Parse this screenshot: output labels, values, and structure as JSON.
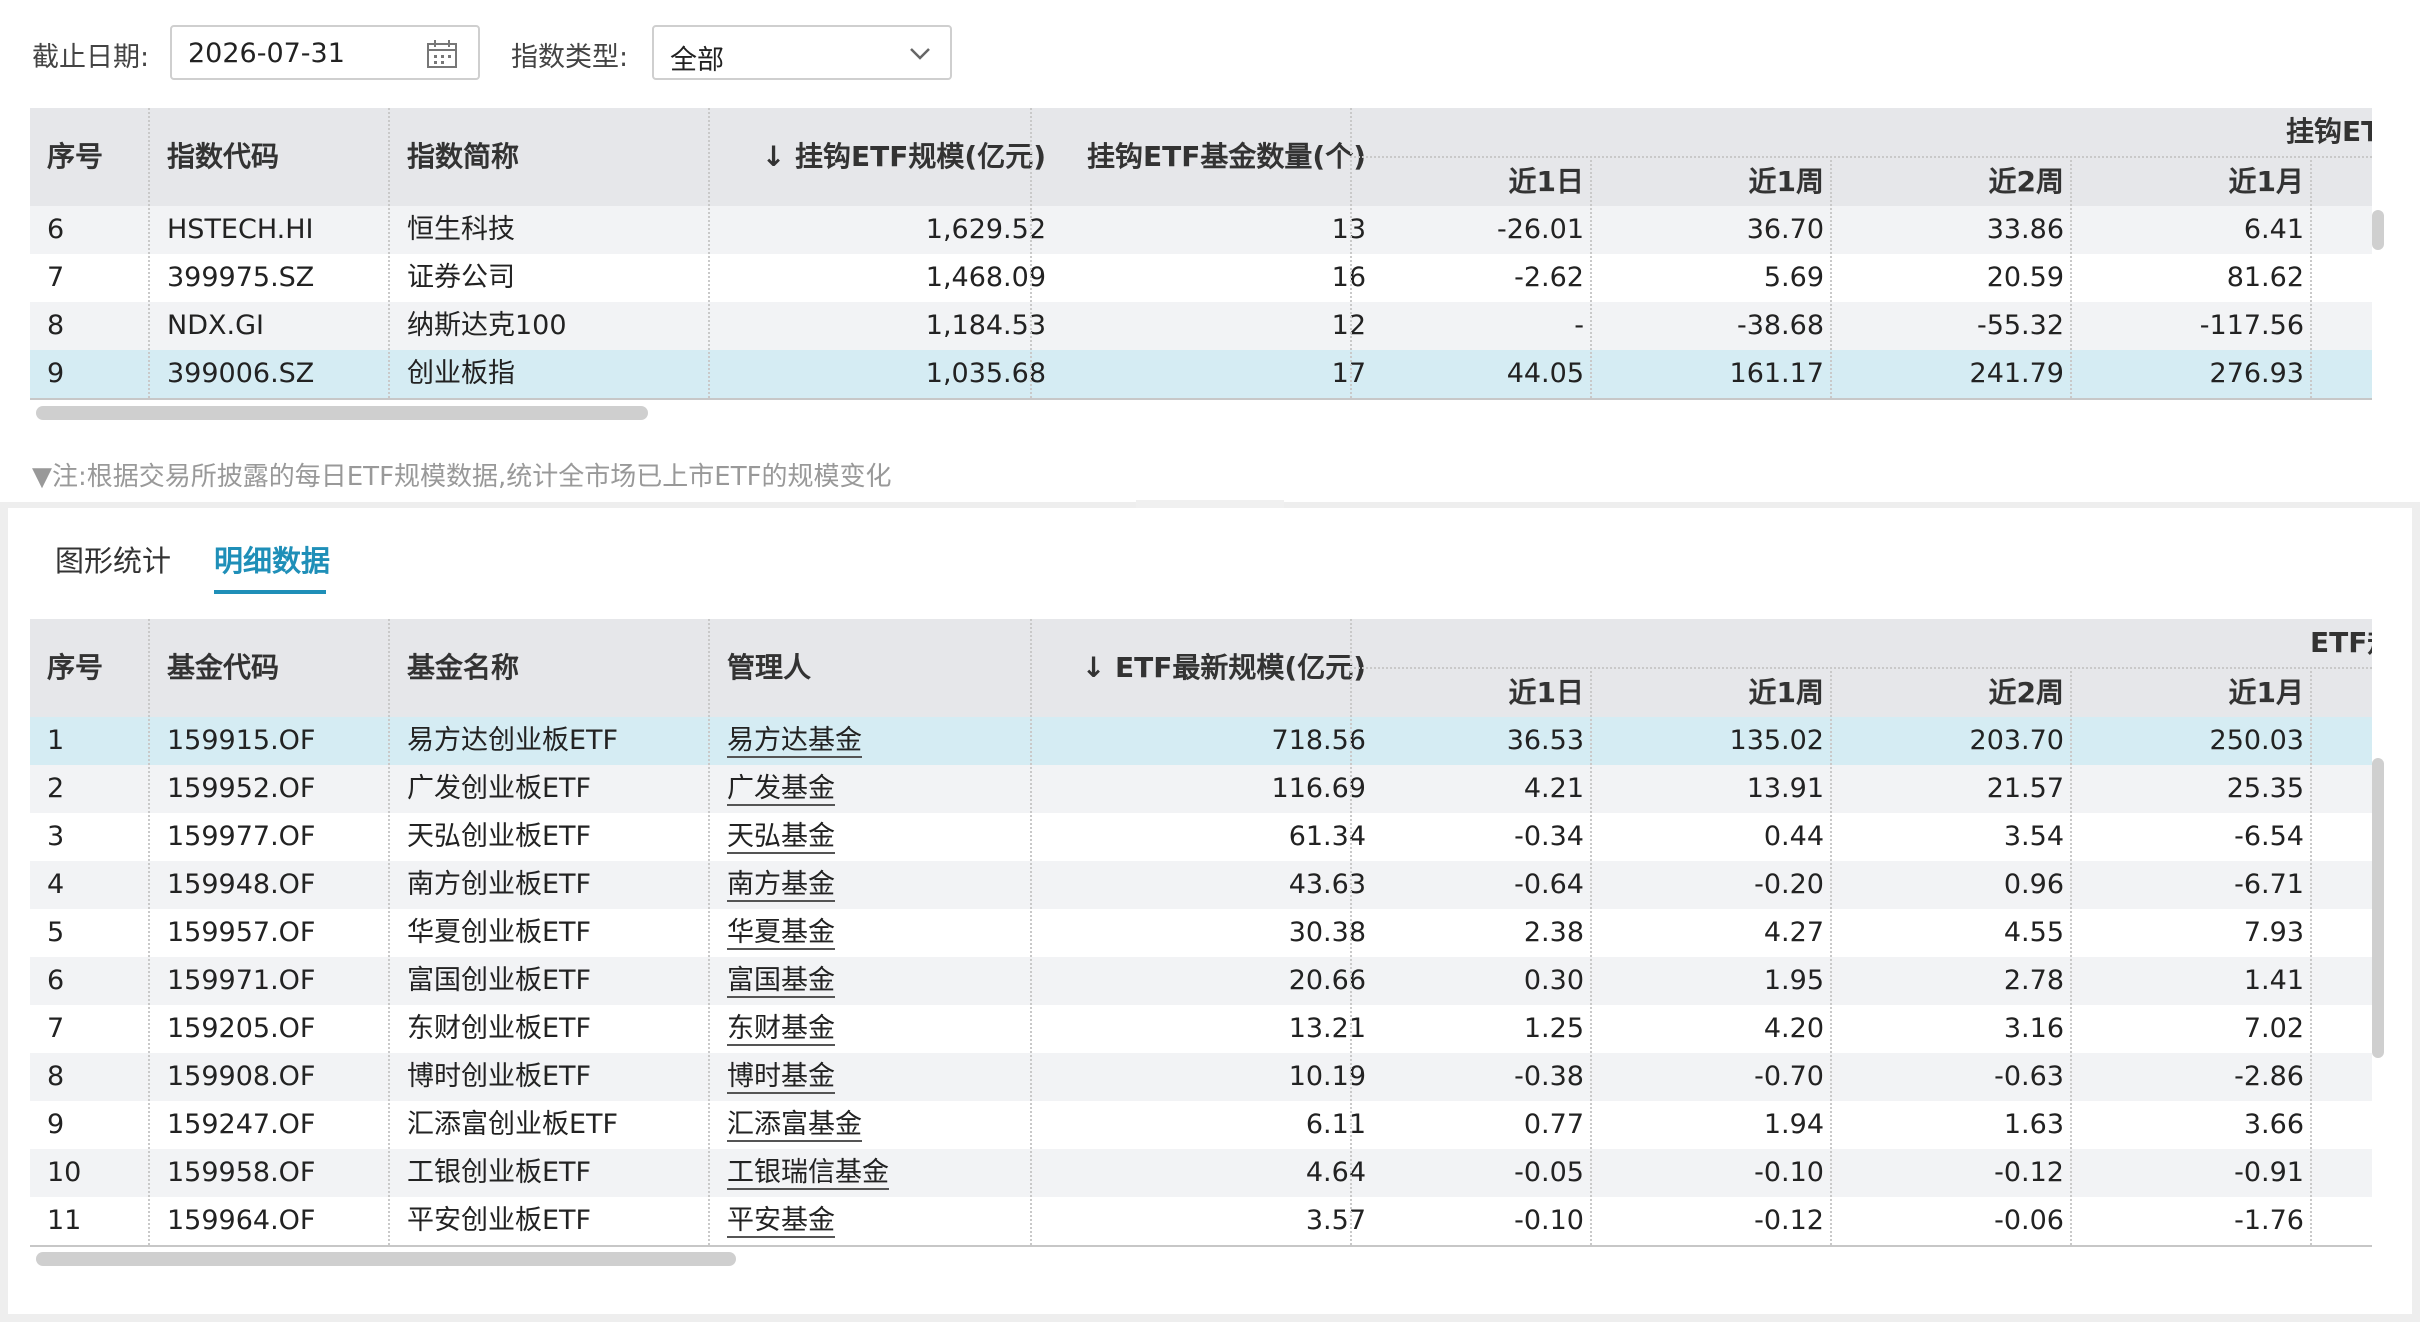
{
  "filters": {
    "date_label": "截止日期:",
    "date_value": "2026-07-31",
    "type_label": "指数类型:",
    "type_value": "全部"
  },
  "index_table": {
    "columns": {
      "seq": "序号",
      "code": "指数代码",
      "name": "指数简称",
      "scale": "↓ 挂钩ETF规模(亿元)",
      "count": "挂钩ETF基金数量(个)",
      "group": "挂钩ET",
      "d1": "近1日",
      "w1": "近1周",
      "w2": "近2周",
      "m1": "近1月"
    },
    "rows": [
      {
        "seq": "6",
        "code": "HSTECH.HI",
        "name": "恒生科技",
        "scale": "1,629.52",
        "count": "13",
        "d1": "-26.01",
        "w1": "36.70",
        "w2": "33.86",
        "m1": "6.41"
      },
      {
        "seq": "7",
        "code": "399975.SZ",
        "name": "证券公司",
        "scale": "1,468.09",
        "count": "16",
        "d1": "-2.62",
        "w1": "5.69",
        "w2": "20.59",
        "m1": "81.62"
      },
      {
        "seq": "8",
        "code": "NDX.GI",
        "name": "纳斯达克100",
        "scale": "1,184.53",
        "count": "12",
        "d1": "-",
        "w1": "-38.68",
        "w2": "-55.32",
        "m1": "-117.56"
      },
      {
        "seq": "9",
        "code": "399006.SZ",
        "name": "创业板指",
        "scale": "1,035.68",
        "count": "17",
        "d1": "44.05",
        "w1": "161.17",
        "w2": "241.79",
        "m1": "276.93"
      }
    ],
    "selected_row": 3
  },
  "note": "▼注:根据交易所披露的每日ETF规模数据,统计全市场已上市ETF的规模变化",
  "collapse_glyph": "⌄⌄",
  "tabs": [
    {
      "label": "图形统计",
      "active": false
    },
    {
      "label": "明细数据",
      "active": true
    }
  ],
  "fund_table": {
    "columns": {
      "seq": "序号",
      "code": "基金代码",
      "name": "基金名称",
      "manager": "管理人",
      "scale": "↓ ETF最新规模(亿元)",
      "group": "ETF规",
      "d1": "近1日",
      "w1": "近1周",
      "w2": "近2周",
      "m1": "近1月"
    },
    "rows": [
      {
        "seq": "1",
        "code": "159915.OF",
        "name": "易方达创业板ETF",
        "manager": "易方达基金",
        "scale": "718.56",
        "d1": "36.53",
        "w1": "135.02",
        "w2": "203.70",
        "m1": "250.03"
      },
      {
        "seq": "2",
        "code": "159952.OF",
        "name": "广发创业板ETF",
        "manager": "广发基金",
        "scale": "116.69",
        "d1": "4.21",
        "w1": "13.91",
        "w2": "21.57",
        "m1": "25.35"
      },
      {
        "seq": "3",
        "code": "159977.OF",
        "name": "天弘创业板ETF",
        "manager": "天弘基金",
        "scale": "61.34",
        "d1": "-0.34",
        "w1": "0.44",
        "w2": "3.54",
        "m1": "-6.54"
      },
      {
        "seq": "4",
        "code": "159948.OF",
        "name": "南方创业板ETF",
        "manager": "南方基金",
        "scale": "43.63",
        "d1": "-0.64",
        "w1": "-0.20",
        "w2": "0.96",
        "m1": "-6.71"
      },
      {
        "seq": "5",
        "code": "159957.OF",
        "name": "华夏创业板ETF",
        "manager": "华夏基金",
        "scale": "30.38",
        "d1": "2.38",
        "w1": "4.27",
        "w2": "4.55",
        "m1": "7.93"
      },
      {
        "seq": "6",
        "code": "159971.OF",
        "name": "富国创业板ETF",
        "manager": "富国基金",
        "scale": "20.66",
        "d1": "0.30",
        "w1": "1.95",
        "w2": "2.78",
        "m1": "1.41"
      },
      {
        "seq": "7",
        "code": "159205.OF",
        "name": "东财创业板ETF",
        "manager": "东财基金",
        "scale": "13.21",
        "d1": "1.25",
        "w1": "4.20",
        "w2": "3.16",
        "m1": "7.02"
      },
      {
        "seq": "8",
        "code": "159908.OF",
        "name": "博时创业板ETF",
        "manager": "博时基金",
        "scale": "10.19",
        "d1": "-0.38",
        "w1": "-0.70",
        "w2": "-0.63",
        "m1": "-2.86"
      },
      {
        "seq": "9",
        "code": "159247.OF",
        "name": "汇添富创业板ETF",
        "manager": "汇添富基金",
        "scale": "6.11",
        "d1": "0.77",
        "w1": "1.94",
        "w2": "1.63",
        "m1": "3.66"
      },
      {
        "seq": "10",
        "code": "159958.OF",
        "name": "工银创业板ETF",
        "manager": "工银瑞信基金",
        "scale": "4.64",
        "d1": "-0.05",
        "w1": "-0.10",
        "w2": "-0.12",
        "m1": "-0.91"
      },
      {
        "seq": "11",
        "code": "159964.OF",
        "name": "平安创业板ETF",
        "manager": "平安基金",
        "scale": "3.57",
        "d1": "-0.10",
        "w1": "-0.12",
        "w2": "-0.06",
        "m1": "-1.76"
      }
    ],
    "selected_row": 0
  },
  "colors": {
    "accent": "#1f8fb8",
    "header_bg": "#e6e7ea",
    "selected_row": "#d5ecf3",
    "stripe_row": "#f2f3f5"
  },
  "icons": {
    "calendar": "calendar-icon",
    "dropdown": "chevron-down-icon"
  }
}
